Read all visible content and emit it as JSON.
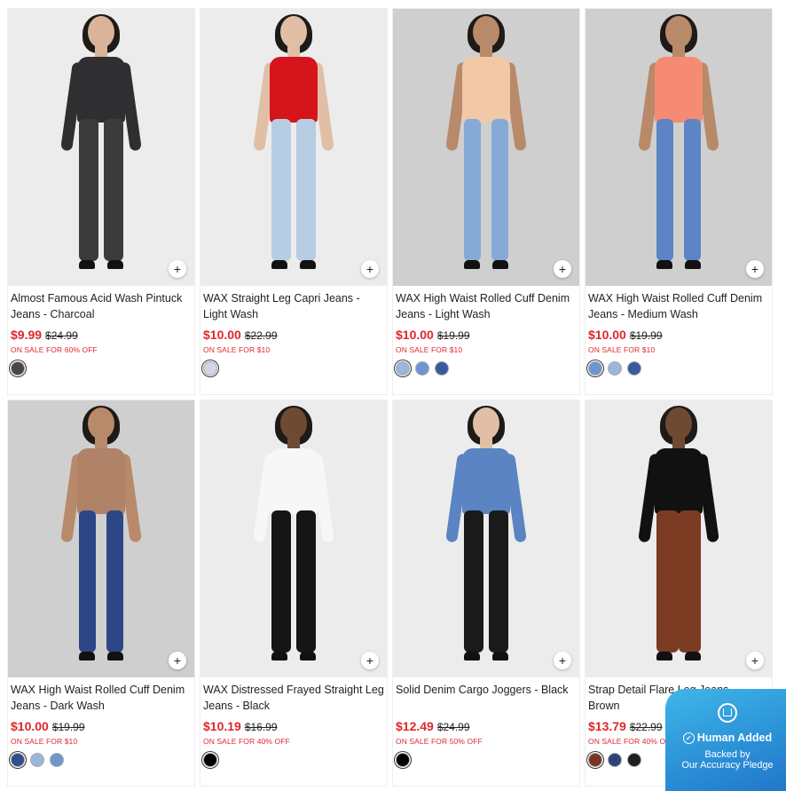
{
  "products": [
    {
      "name": "Almost Famous Acid Wash Pintuck Jeans - Charcoal",
      "sale": "$9.99",
      "orig": "$24.99",
      "promo": "ON SALE FOR 60% OFF",
      "swatches": [
        "#4a4644"
      ],
      "look": {
        "bg": "light",
        "skin": "#d9b49a",
        "top": "#2f2f31",
        "pants": "#3b3b3b",
        "legs": "straight"
      }
    },
    {
      "name": "WAX Straight Leg Capri Jeans - Light Wash",
      "sale": "$10.00",
      "orig": "$22.99",
      "promo": "ON SALE FOR $10",
      "swatches": [
        "#cfd8e4"
      ],
      "look": {
        "bg": "light",
        "skin": "#e0bfa6",
        "top": "#d6141b",
        "pants": "#b7cde3",
        "legs": "straight"
      }
    },
    {
      "name": "WAX High Waist Rolled Cuff Denim Jeans - Light Wash",
      "sale": "$10.00",
      "orig": "$19.99",
      "promo": "ON SALE FOR $10",
      "swatches": [
        "#9ab6dc",
        "#6f95cf",
        "#3c5a99"
      ],
      "look": {
        "bg": "gray",
        "skin": "#b88a6a",
        "top": "#f1c9a6",
        "pants": "#86aad6",
        "legs": "skinny"
      }
    },
    {
      "name": "WAX High Waist Rolled Cuff Denim Jeans - Medium Wash",
      "sale": "$10.00",
      "orig": "$19.99",
      "promo": "ON SALE FOR $10",
      "swatches": [
        "#6f95cf",
        "#9ab6dc",
        "#3c5a99"
      ],
      "look": {
        "bg": "gray",
        "skin": "#b88a6a",
        "top": "#f58b72",
        "pants": "#5d84c4",
        "legs": "skinny"
      }
    },
    {
      "name": "WAX High Waist Rolled Cuff Denim Jeans - Dark Wash",
      "sale": "$10.00",
      "orig": "$19.99",
      "promo": "ON SALE FOR $10",
      "swatches": [
        "#304f8d",
        "#9ab6dc",
        "#6f95cf"
      ],
      "look": {
        "bg": "gray",
        "skin": "#b88a6a",
        "top": "#b08268",
        "pants": "#2d4786",
        "legs": "skinny"
      }
    },
    {
      "name": "WAX Distressed Frayed Straight Leg Jeans - Black",
      "sale": "$10.19",
      "orig": "$16.99",
      "promo": "ON SALE FOR 40% OFF",
      "swatches": [
        "#000000"
      ],
      "look": {
        "bg": "light",
        "skin": "#6f4a33",
        "top": "#f7f7f7",
        "pants": "#151515",
        "legs": "straight"
      }
    },
    {
      "name": "Solid Denim Cargo Joggers - Black",
      "sale": "$12.49",
      "orig": "$24.99",
      "promo": "ON SALE FOR 50% OFF",
      "swatches": [
        "#000000"
      ],
      "look": {
        "bg": "light",
        "skin": "#e0bfa6",
        "top": "#5a84c2",
        "pants": "#1a1a1a",
        "legs": "straight"
      }
    },
    {
      "name": "Strap Detail Flare Leg Jeans - Brown",
      "sale": "$13.79",
      "orig": "$22.99",
      "promo": "ON SALE FOR 40% OFF",
      "swatches": [
        "#7a3527",
        "#2e4378",
        "#1f1f1f"
      ],
      "look": {
        "bg": "light",
        "skin": "#6f4a33",
        "top": "#111111",
        "pants": "#7b3a22",
        "legs": "flare"
      }
    }
  ],
  "plus_symbol": "+",
  "badge": {
    "title": "Human Added",
    "subtitle": "Backed by\nOur Accuracy Pledge",
    "check": "✓",
    "colors": [
      "#3fb7e8",
      "#2276c9"
    ]
  }
}
